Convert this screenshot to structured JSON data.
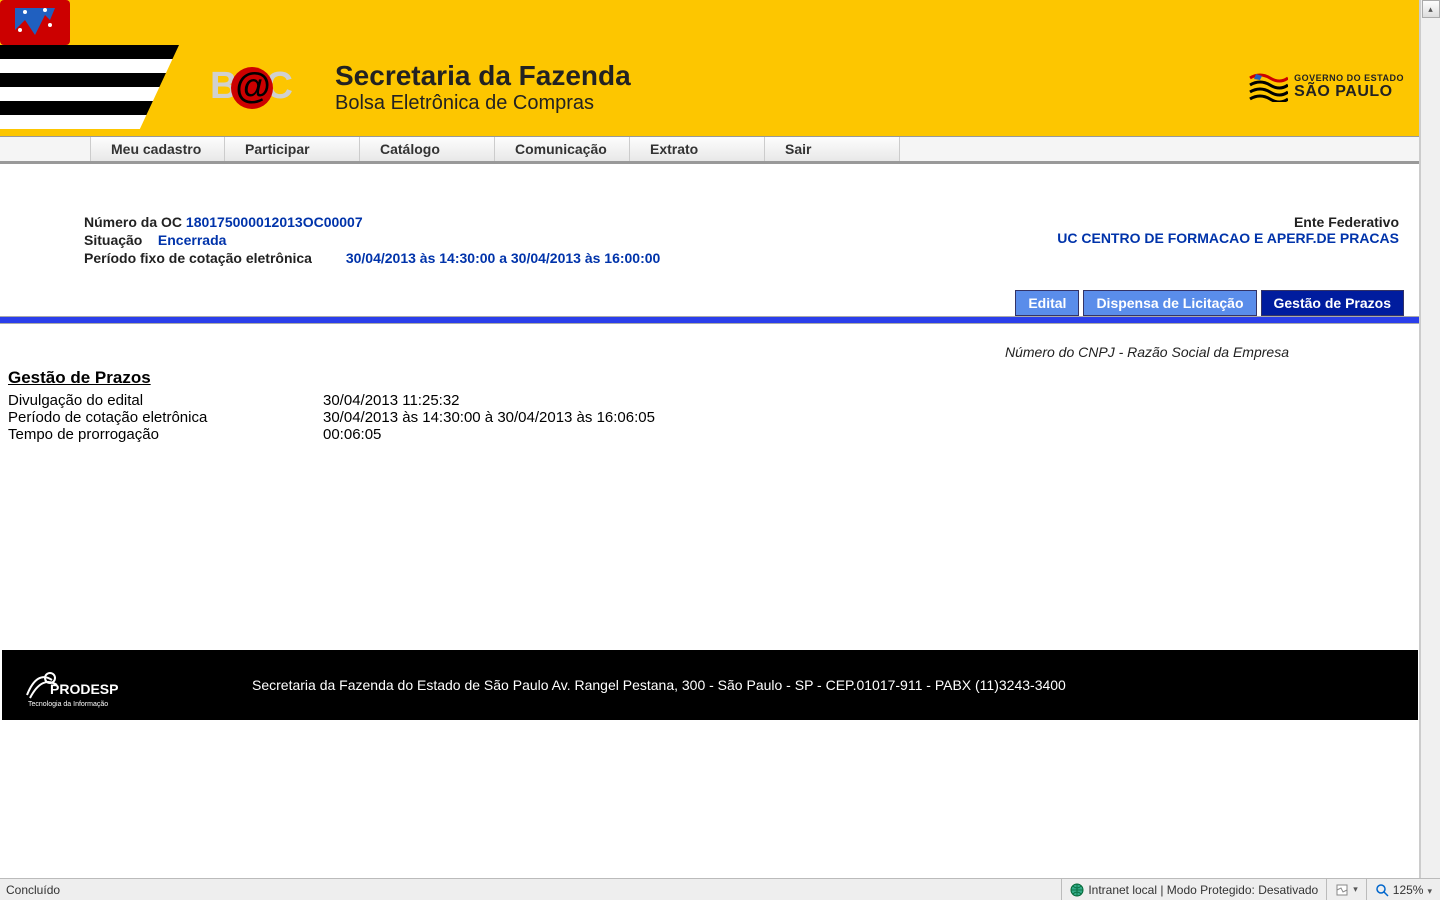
{
  "header": {
    "logo_prefix": "B",
    "logo_suffix": "C",
    "title": "Secretaria da Fazenda",
    "subtitle": "Bolsa Eletrônica de Compras",
    "gov_top": "GOVERNO DO ESTADO",
    "gov_bottom": "SÃO PAULO"
  },
  "menu": {
    "items": [
      "Meu cadastro",
      "Participar",
      "Catálogo",
      "Comunicação",
      "Extrato",
      "Sair"
    ]
  },
  "info": {
    "oc_label": "Número da OC",
    "oc_value": "180175000012013OC00007",
    "situacao_label": "Situação",
    "situacao_value": "Encerrada",
    "periodo_label": "Período fixo de cotação eletrônica",
    "periodo_value": "30/04/2013 às 14:30:00 a 30/04/2013 às 16:00:00",
    "ente_label": "Ente Federativo",
    "uc_prefix": "UC",
    "uc_value": "CENTRO DE FORMACAO E APERF.DE PRACAS"
  },
  "tabs": {
    "edital": "Edital",
    "dispensa": "Dispensa de Licitação",
    "gestao": "Gestão de Prazos"
  },
  "cnpj_line": "Número do CNPJ - Razão Social da Empresa",
  "section": {
    "title": "Gestão de Prazos",
    "rows": [
      {
        "label": "Divulgação do edital",
        "value": "30/04/2013 11:25:32"
      },
      {
        "label": "Período de cotação eletrônica",
        "value": "30/04/2013 às 14:30:00 à 30/04/2013 às 16:06:05"
      },
      {
        "label": "Tempo de prorrogação",
        "value": "00:06:05"
      }
    ]
  },
  "footer": {
    "prodesp_top": "PRODESP",
    "prodesp_bottom": "Tecnologia da Informação",
    "text": "Secretaria da Fazenda do Estado de São Paulo Av. Rangel Pestana, 300 - São Paulo - SP - CEP.01017-911 - PABX (11)3243-3400"
  },
  "statusbar": {
    "left": "Concluído",
    "zone": "Intranet local | Modo Protegido: Desativado",
    "zoom": "125%"
  }
}
